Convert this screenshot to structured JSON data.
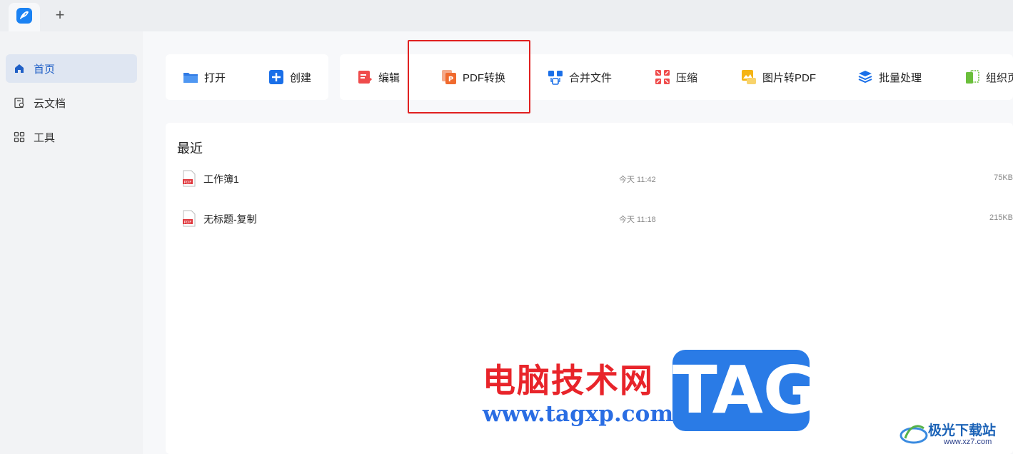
{
  "tabs": {
    "new_tab_symbol": "+"
  },
  "sidebar": {
    "items": [
      {
        "label": "首页",
        "icon": "home-icon",
        "active": true
      },
      {
        "label": "云文档",
        "icon": "cloud-doc-icon",
        "active": false
      },
      {
        "label": "工具",
        "icon": "tools-grid-icon",
        "active": false
      }
    ]
  },
  "toolbar": {
    "open": "打开",
    "create": "创建",
    "edit": "编辑",
    "pdf_convert": "PDF转换",
    "merge": "合并文件",
    "compress": "压缩",
    "image_to_pdf": "图片转PDF",
    "batch": "批量处理",
    "organize": "组织页"
  },
  "recent": {
    "title": "最近",
    "files": [
      {
        "name": "工作簿1",
        "time": "今天 11:42",
        "size": "75KB"
      },
      {
        "name": "无标题-复制",
        "time": "今天 11:18",
        "size": "215KB"
      }
    ]
  },
  "watermark": {
    "cn": "电脑技术网",
    "url": "www.tagxp.com",
    "tag": "TAG",
    "site": "极光下载站",
    "site_url": "www.xz7.com"
  },
  "colors": {
    "accent": "#1a82f3",
    "highlight": "#e02020",
    "watermark_red": "#e8242a",
    "watermark_blue": "#2a7be6"
  }
}
